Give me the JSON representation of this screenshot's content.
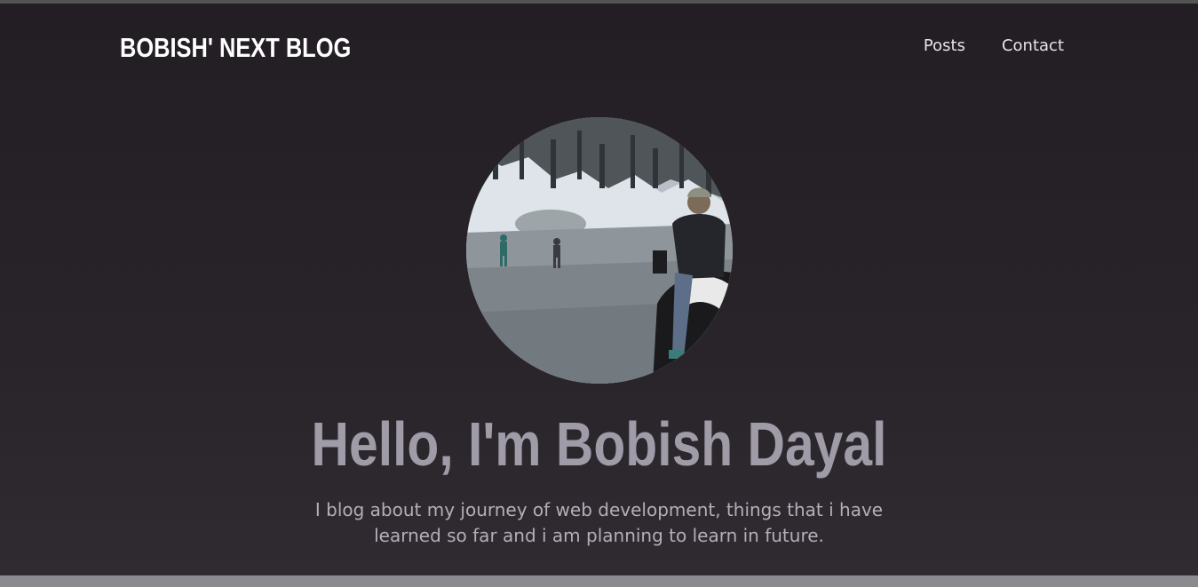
{
  "header": {
    "logo": "BOBISH' NEXT BLOG",
    "nav": {
      "posts": "Posts",
      "contact": "Contact"
    }
  },
  "hero": {
    "title": "Hello, I'm Bobish Dayal",
    "subtitle": "I blog about my journey of web development, things that i have learned so far and i am planning to learn in future."
  },
  "colors": {
    "background": "#231f24",
    "logo": "#ffffff",
    "nav_text": "#e6e3ea",
    "title": "#9f9ba7",
    "subtitle": "#b3aeb9"
  }
}
